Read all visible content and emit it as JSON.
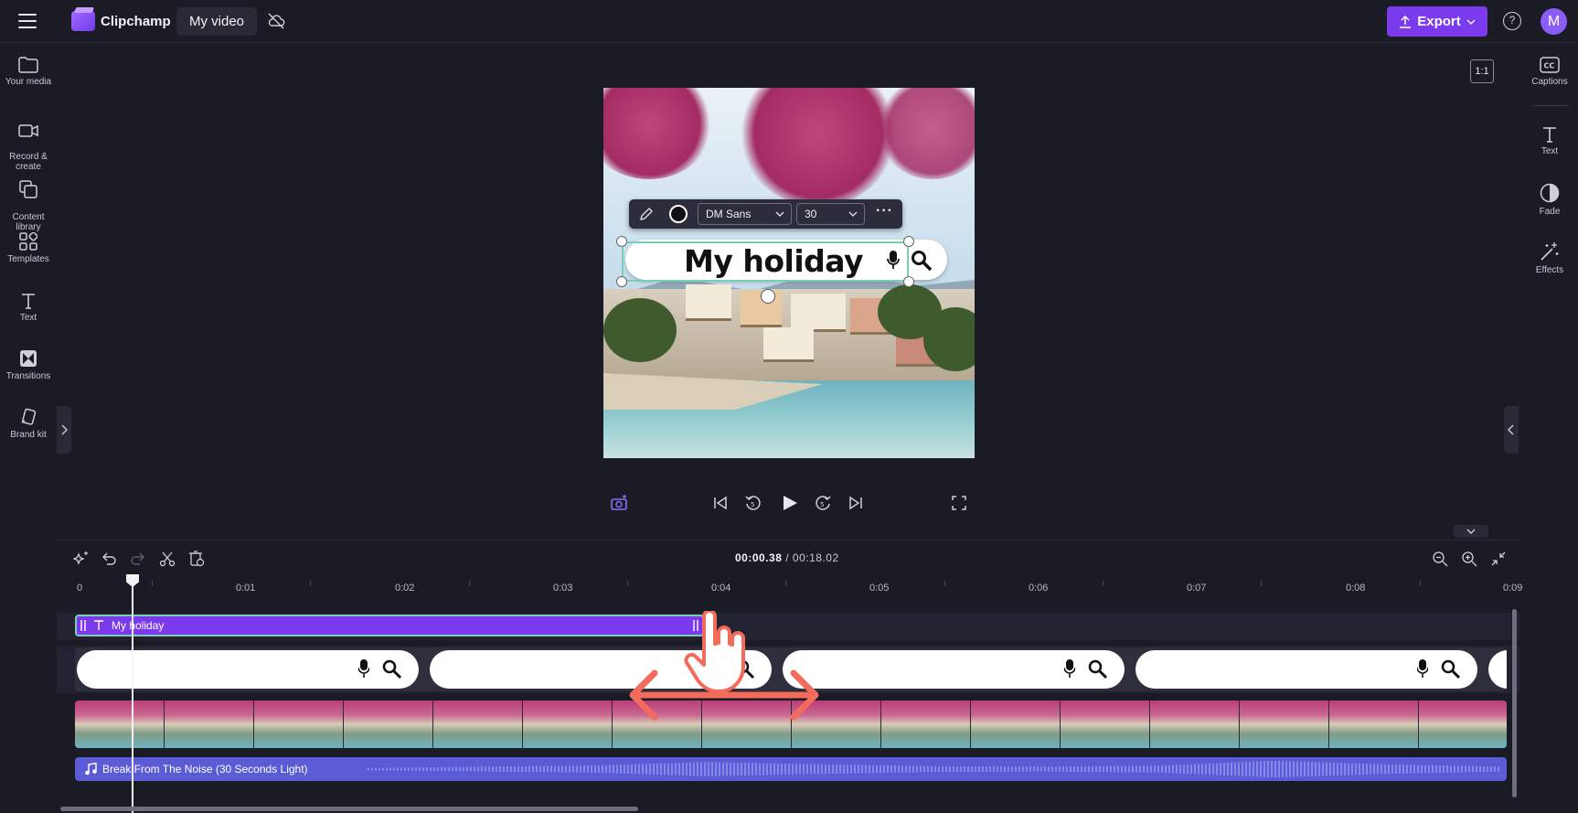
{
  "topbar": {
    "app_name": "Clipchamp",
    "project_name": "My video",
    "export_label": "Export",
    "help_glyph": "?",
    "avatar_initial": "M"
  },
  "leftbar": {
    "items": [
      {
        "label": "Your media",
        "icon": "folder-icon"
      },
      {
        "label": "Record &\ncreate",
        "icon": "camera-icon"
      },
      {
        "label": "Content\nlibrary",
        "icon": "library-icon"
      },
      {
        "label": "Templates",
        "icon": "templates-icon"
      },
      {
        "label": "Text",
        "icon": "text-icon"
      },
      {
        "label": "Transitions",
        "icon": "transitions-icon"
      },
      {
        "label": "Brand kit",
        "icon": "brand-kit-icon"
      }
    ]
  },
  "rightbar": {
    "items": [
      {
        "label": "Captions",
        "icon": "captions-icon"
      },
      {
        "label": "Text",
        "icon": "text-icon"
      },
      {
        "label": "Fade",
        "icon": "fade-icon"
      },
      {
        "label": "Effects",
        "icon": "effects-icon"
      }
    ]
  },
  "preview": {
    "aspect_ratio": "1:1",
    "overlay_text": "My holiday"
  },
  "text_toolbar": {
    "font": "DM Sans",
    "size": "30",
    "more": "···"
  },
  "timeline": {
    "current_time": "00:00.38",
    "separator": "/",
    "total_time": "00:18.02",
    "ruler_labels": [
      "0",
      "0:01",
      "0:02",
      "0:03",
      "0:04",
      "0:05",
      "0:06",
      "0:07",
      "0:08",
      "0:09"
    ],
    "text_clip_label": "My holiday",
    "audio_clip_label": "Break From The Noise (30 Seconds Light)"
  },
  "colors": {
    "accent": "#7c3aed",
    "audio": "#5b5bd6",
    "selection": "#7ad0b4",
    "drag_arrow": "#f26b5b"
  }
}
